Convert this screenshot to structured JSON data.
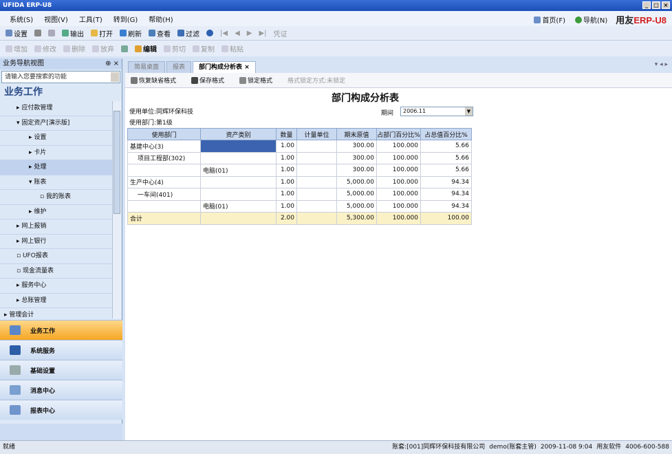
{
  "window": {
    "title": "UFIDA ERP-U8"
  },
  "menu": [
    "系统(S)",
    "视图(V)",
    "工具(T)",
    "转到(G)",
    "帮助(H)"
  ],
  "topnav": {
    "home": "首页(F)",
    "nav": "导航(N)",
    "brand_a": "用友",
    "brand_b": "ERP",
    "brand_c": "-U8"
  },
  "toolbar1": [
    "设置",
    "输出",
    "打开",
    "刷新",
    "查看",
    "过滤",
    "凭证"
  ],
  "toolbar2": [
    "增加",
    "修改",
    "删除",
    "放弃",
    "编辑",
    "剪切",
    "复制",
    "粘贴"
  ],
  "sidebar": {
    "header": "业务导航视图",
    "search_placeholder": "请输入您要搜索的功能",
    "section_title": "业务工作",
    "tree": [
      "应付款管理",
      "固定资产[演示版]",
      "设置",
      "卡片",
      "处理",
      "账表",
      "我的账表",
      "维护",
      "网上报销",
      "网上银行",
      "UFO报表",
      "现金流量表",
      "服务中心",
      "总账管理",
      "管理会计"
    ],
    "nav_buttons": [
      "业务工作",
      "系统服务",
      "基础设置",
      "消息中心",
      "报表中心"
    ]
  },
  "tabs": [
    "简易桌面",
    "报表",
    "部门构成分析表"
  ],
  "report_toolbar": [
    "恢复缺省格式",
    "保存格式",
    "锁定格式",
    "格式锁定方式:未锁定"
  ],
  "report": {
    "title": "部门构成分析表",
    "company": "使用单位:同辉环保科技",
    "level": "使用部门:第1级",
    "period_label": "期间",
    "period_value": "2006.11",
    "columns": [
      "使用部门",
      "资产类别",
      "数量",
      "计量单位",
      "期末原值",
      "占部门百分比%",
      "占总值百分比%"
    ],
    "rows": [
      {
        "dept": "基建中心(3)",
        "cat": "",
        "qty": "1.00",
        "unit": "",
        "orig": "300.00",
        "pct_dept": "100.000",
        "pct_total": "5.66"
      },
      {
        "dept": "项目工程部(302)",
        "cat": "",
        "qty": "1.00",
        "unit": "",
        "orig": "300.00",
        "pct_dept": "100.000",
        "pct_total": "5.66"
      },
      {
        "dept": "",
        "cat": "电脑(01)",
        "qty": "1.00",
        "unit": "",
        "orig": "300.00",
        "pct_dept": "100.000",
        "pct_total": "5.66"
      },
      {
        "dept": "生产中心(4)",
        "cat": "",
        "qty": "1.00",
        "unit": "",
        "orig": "5,000.00",
        "pct_dept": "100.000",
        "pct_total": "94.34"
      },
      {
        "dept": "一车间(401)",
        "cat": "",
        "qty": "1.00",
        "unit": "",
        "orig": "5,000.00",
        "pct_dept": "100.000",
        "pct_total": "94.34"
      },
      {
        "dept": "",
        "cat": "电脑(01)",
        "qty": "1.00",
        "unit": "",
        "orig": "5,000.00",
        "pct_dept": "100.000",
        "pct_total": "94.34"
      },
      {
        "dept": "合计",
        "cat": "",
        "qty": "2.00",
        "unit": "",
        "orig": "5,300.00",
        "pct_dept": "100.000",
        "pct_total": "100.00"
      }
    ]
  },
  "status": {
    "left": "就绪",
    "account": "账套:[001]同辉环保科技有限公司",
    "user": "demo(账套主管)",
    "time": "2009-11-08 9:04",
    "company": "用友软件",
    "phone": "4006-600-588"
  }
}
